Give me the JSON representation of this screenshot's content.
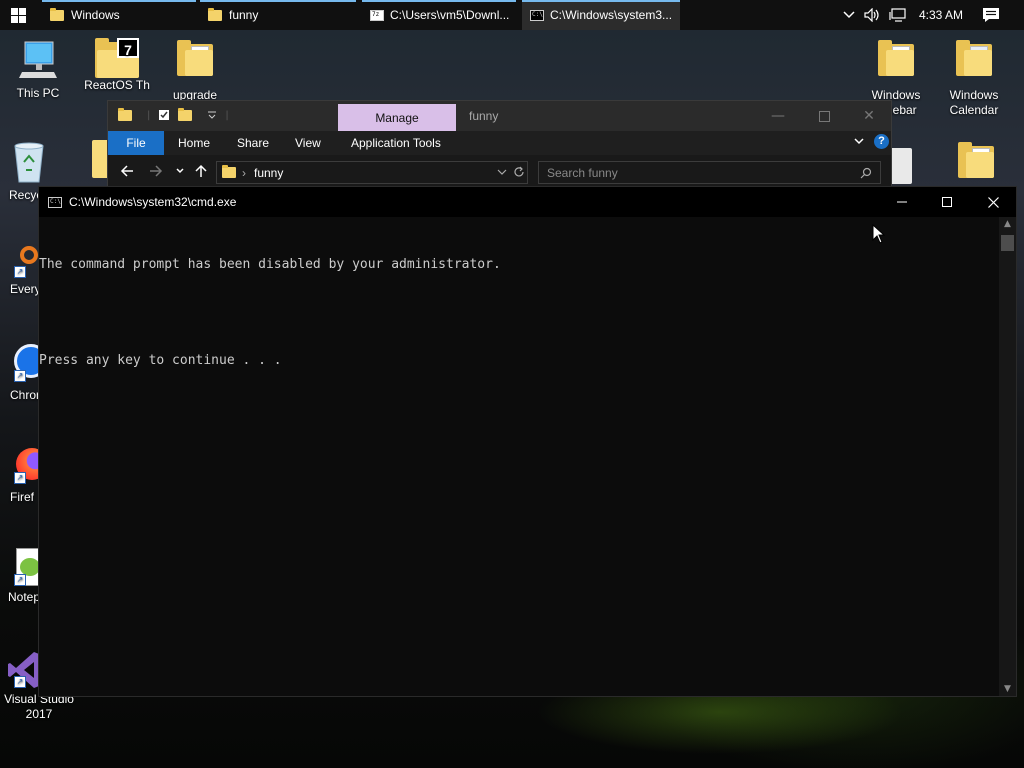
{
  "taskbar": {
    "tasks": [
      {
        "label": "Windows"
      },
      {
        "label": "funny"
      },
      {
        "label": "C:\\Users\\vm5\\Downl..."
      },
      {
        "label": "C:\\Windows\\system3..."
      }
    ],
    "clock": "4:33 AM"
  },
  "desktop": {
    "icons": [
      {
        "label": "This PC"
      },
      {
        "label": "ReactOS Th"
      },
      {
        "label": "upgrade"
      },
      {
        "label": "Windows Sidebar"
      },
      {
        "label": "Windows Calendar"
      },
      {
        "label": "Recycl"
      },
      {
        "label": "Every"
      },
      {
        "label": "Chron"
      },
      {
        "label": "Firef"
      },
      {
        "label": "Notep"
      },
      {
        "label": "Visual Studio 2017"
      }
    ]
  },
  "explorer": {
    "context_tab": "Manage",
    "title": "funny",
    "ribbon_tabs": [
      "File",
      "Home",
      "Share",
      "View",
      "Application Tools"
    ],
    "address": "funny",
    "search_placeholder": "Search funny"
  },
  "cmd": {
    "title": "C:\\Windows\\system32\\cmd.exe",
    "lines": [
      "The command prompt has been disabled by your administrator.",
      "",
      "Press any key to continue . . ."
    ]
  },
  "colors": {
    "accent_blue": "#1a6fc6",
    "manage_tab": "#d9bfe8",
    "console_text": "#cccccc"
  }
}
